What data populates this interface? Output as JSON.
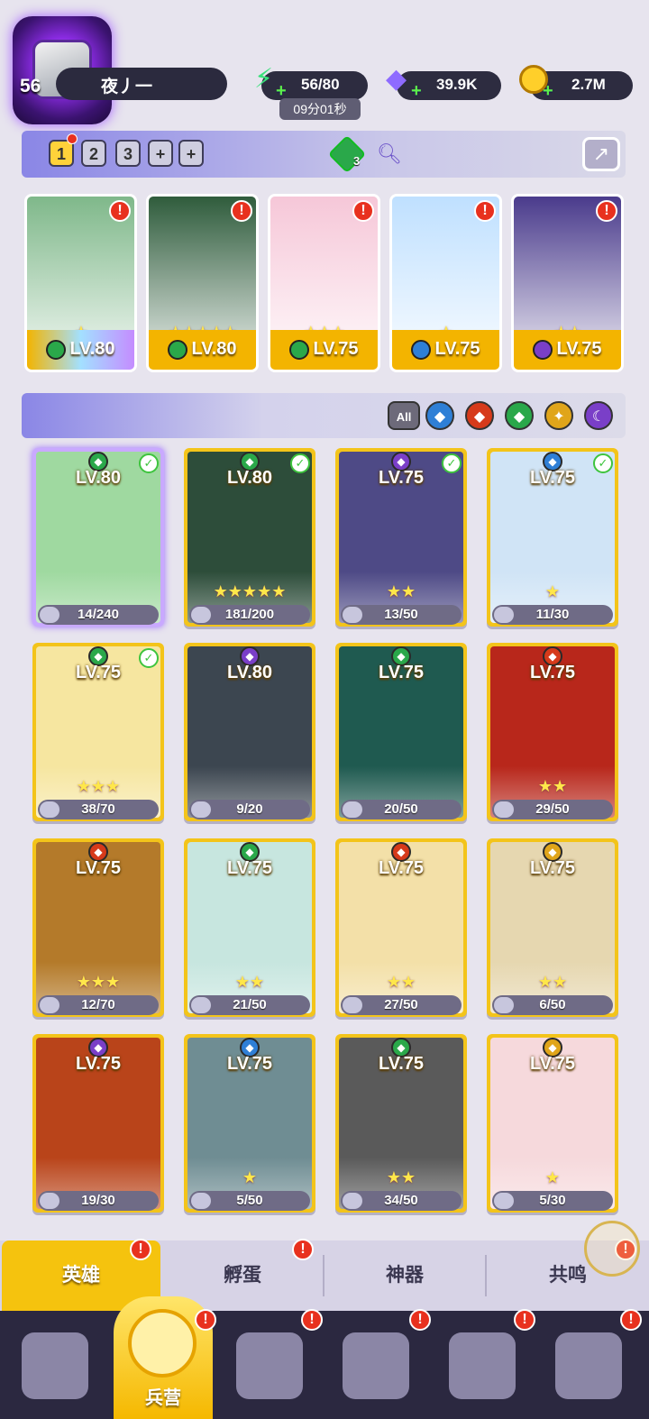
{
  "player": {
    "level": "56",
    "name": "夜丿一"
  },
  "resources": {
    "energy": "56/80",
    "energy_timer": "09分01秒",
    "gems": "39.9K",
    "gold": "2.7M"
  },
  "team_bar": {
    "tabs": [
      "1",
      "2",
      "3",
      "+",
      "+"
    ],
    "active_tab": "1",
    "slot_count": "3"
  },
  "team": [
    {
      "level": "LV.80",
      "stars": "★",
      "element": "nature",
      "color": "#7fb88a"
    },
    {
      "level": "LV.80",
      "stars": "★★★★★",
      "element": "nature",
      "color": "#2f5c3c"
    },
    {
      "level": "LV.75",
      "stars": "★★★",
      "element": "nature",
      "color": "#f6c7d8"
    },
    {
      "level": "LV.75",
      "stars": "★",
      "element": "water",
      "color": "#bfe0ff"
    },
    {
      "level": "LV.75",
      "stars": "★★",
      "element": "dark",
      "color": "#4a3b8c"
    }
  ],
  "filters": {
    "all_label": "All",
    "elements": [
      "water",
      "fire",
      "nature",
      "light",
      "dark"
    ]
  },
  "heroes": [
    {
      "level": "LV.80",
      "shards": "14/240",
      "stars": "",
      "element": "nature",
      "checked": true,
      "color": "#9fd9a0"
    },
    {
      "level": "LV.80",
      "shards": "181/200",
      "stars": "★★★★★",
      "element": "nature",
      "checked": true,
      "color": "#2d4d3a"
    },
    {
      "level": "LV.75",
      "shards": "13/50",
      "stars": "★★",
      "element": "dark",
      "checked": true,
      "color": "#4e4a86"
    },
    {
      "level": "LV.75",
      "shards": "11/30",
      "stars": "★",
      "element": "water",
      "checked": true,
      "color": "#d0e4f6"
    },
    {
      "level": "LV.75",
      "shards": "38/70",
      "stars": "★★★",
      "element": "nature",
      "checked": true,
      "color": "#f6e6a0"
    },
    {
      "level": "LV.80",
      "shards": "9/20",
      "stars": "",
      "element": "dark",
      "checked": false,
      "color": "#3c4650"
    },
    {
      "level": "LV.75",
      "shards": "20/50",
      "stars": "",
      "element": "nature",
      "checked": false,
      "color": "#1f5a50"
    },
    {
      "level": "LV.75",
      "shards": "29/50",
      "stars": "★★",
      "element": "fire",
      "checked": false,
      "color": "#b8271b"
    },
    {
      "level": "LV.75",
      "shards": "12/70",
      "stars": "★★★",
      "element": "fire",
      "checked": false,
      "color": "#b47a2a"
    },
    {
      "level": "LV.75",
      "shards": "21/50",
      "stars": "★★",
      "element": "nature",
      "checked": false,
      "color": "#c7e6df"
    },
    {
      "level": "LV.75",
      "shards": "27/50",
      "stars": "★★",
      "element": "fire",
      "checked": false,
      "color": "#f3e0a8"
    },
    {
      "level": "LV.75",
      "shards": "6/50",
      "stars": "★★",
      "element": "light",
      "checked": false,
      "color": "#e6d7b0"
    },
    {
      "level": "LV.75",
      "shards": "19/30",
      "stars": "",
      "element": "dark",
      "checked": false,
      "color": "#b9441a"
    },
    {
      "level": "LV.75",
      "shards": "5/50",
      "stars": "★",
      "element": "water",
      "checked": false,
      "color": "#6f8d93"
    },
    {
      "level": "LV.75",
      "shards": "34/50",
      "stars": "★★",
      "element": "nature",
      "checked": false,
      "color": "#5a5a5a"
    },
    {
      "level": "LV.75",
      "shards": "5/30",
      "stars": "★",
      "element": "light",
      "checked": false,
      "color": "#f6d9dc"
    }
  ],
  "element_colors": {
    "water": "#2e7fd6",
    "fire": "#d63a1a",
    "nature": "#2aa84a",
    "light": "#e0a51a",
    "dark": "#7a3fc8"
  },
  "subtabs": [
    "英雄",
    "孵蛋",
    "神器",
    "共鸣"
  ],
  "bottom_nav": {
    "active_label": "兵营"
  }
}
